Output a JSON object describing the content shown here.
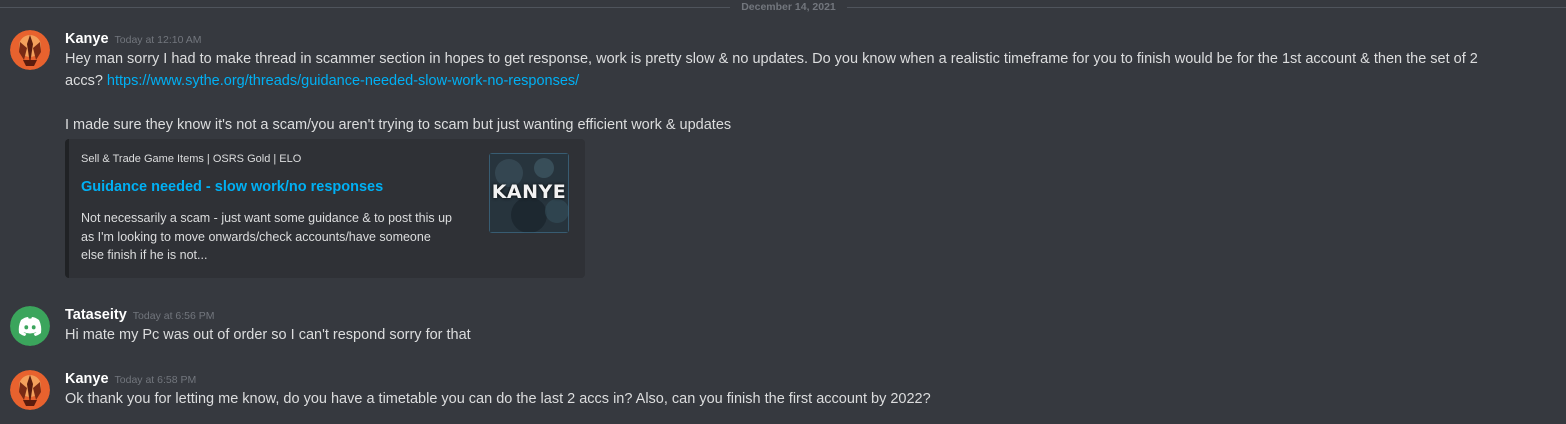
{
  "divider": {
    "date": "December 14, 2021"
  },
  "messages": [
    {
      "username": "Kanye",
      "timestamp": "Today at 12:10 AM",
      "avatar_icon": "kanye-avatar-icon",
      "lines": [
        "Hey man sorry I had to make thread in scammer section in hopes to get response, work is pretty slow & no updates. Do you know when a realistic timeframe for you to finish would be for the 1st account & then the set of 2",
        "accs?"
      ],
      "link": "https://www.sythe.org/threads/guidance-needed-slow-work-no-responses/",
      "line3": "I made sure they know it's not a scam/you aren't trying to scam but just wanting efficient work & updates",
      "embed": {
        "provider": "Sell & Trade Game Items | OSRS Gold | ELO",
        "title": "Guidance needed - slow work/no responses",
        "description": [
          "Not necessarily a scam - just want some guidance & to post this up",
          "as I'm looking to move onwards/check accounts/have someone",
          "else finish if he is not..."
        ],
        "thumbnail_text": "KANYE"
      }
    },
    {
      "username": "Tataseity",
      "timestamp": "Today at 6:56 PM",
      "avatar_icon": "discord-logo-icon",
      "text": "Hi mate my Pc was out of order so I can't respond sorry for that"
    },
    {
      "username": "Kanye",
      "timestamp": "Today at 6:58 PM",
      "avatar_icon": "kanye-avatar-icon",
      "text": "Ok thank you for letting me know, do you have a timetable you can do the last 2 accs in? Also, can you finish the first account by 2022?"
    }
  ],
  "colors": {
    "background": "#36393f",
    "link": "#00b0f4",
    "username": "#ffffff",
    "timestamp": "#72767d",
    "embed_bg": "#2f3136",
    "discord_green": "#3ba55c",
    "kanye_avatar": "#e8622e"
  }
}
